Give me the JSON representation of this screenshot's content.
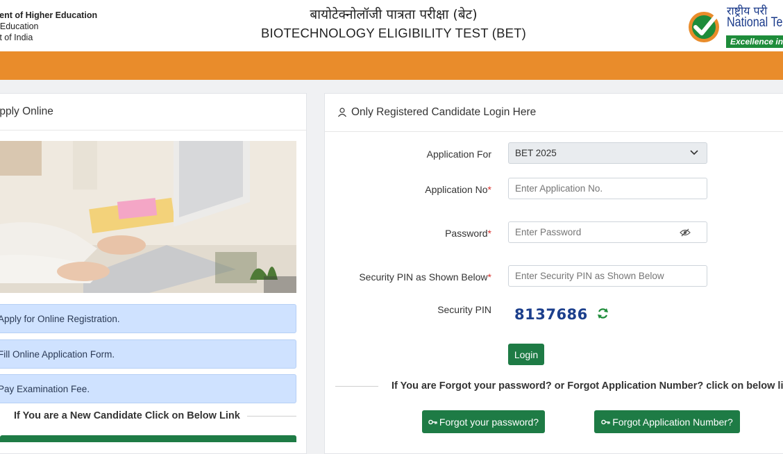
{
  "header": {
    "ministry_line1": "ment of Higher Education",
    "ministry_line2": "of Education",
    "ministry_line3": "ment of India",
    "title_hindi": "बायोटेक्नोलॉजी पात्रता परीक्षा (बेट)",
    "title_english": "BIOTECHNOLOGY ELIGIBILITY TEST (BET)",
    "nta_hindi": "राष्ट्रीय परी",
    "nta_english": "National Tes",
    "nta_tagline": "Excellence in"
  },
  "left_panel": {
    "heading": "Apply Online",
    "steps": [
      "Apply for Online Registration.",
      "Fill Online Application Form.",
      "Pay Examination Fee."
    ],
    "new_candidate_text": "If You are a New Candidate Click on Below Link"
  },
  "login_panel": {
    "heading": "Only Registered Candidate Login Here",
    "application_for_label": "Application For",
    "application_for_value": "BET 2025",
    "application_no_label": "Application No",
    "application_no_placeholder": "Enter Application No.",
    "password_label": "Password",
    "password_placeholder": "Enter Password",
    "security_pin_input_label": "Security PIN as Shown Below",
    "security_pin_placeholder": "Enter Security PIN as Shown Below",
    "security_pin_label": "Security PIN",
    "captcha_value": "8137686",
    "required_marker": "*",
    "login_button": "Login",
    "forgot_text": "If You are Forgot your password? or Forgot Application Number? click on below link",
    "forgot_password_button": "Forgot your password?",
    "forgot_application_button": "Forgot Application Number?"
  },
  "colors": {
    "orange_bar": "#e98c2b",
    "primary_green": "#1e7b45",
    "step_blue": "#cfe2ff",
    "nta_blue": "#1a3a8a"
  },
  "icons": {
    "user": "user-icon",
    "chevron": "chevron-down-icon",
    "eye": "eye-slash-icon",
    "refresh": "refresh-icon",
    "key": "key-icon",
    "logo": "nta-checkmark-logo"
  }
}
